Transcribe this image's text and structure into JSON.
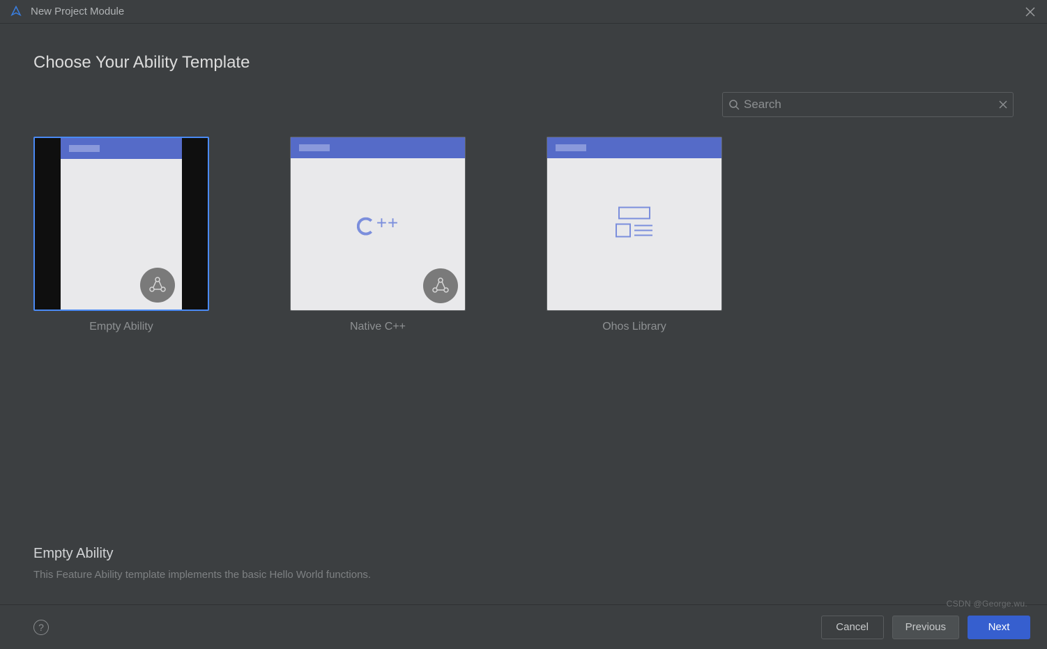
{
  "window": {
    "title": "New Project Module"
  },
  "page": {
    "heading": "Choose Your Ability Template"
  },
  "search": {
    "placeholder": "Search",
    "value": ""
  },
  "templates": [
    {
      "id": "empty-ability",
      "label": "Empty Ability",
      "selected": true
    },
    {
      "id": "native-cpp",
      "label": "Native C++",
      "selected": false
    },
    {
      "id": "ohos-library",
      "label": "Ohos Library",
      "selected": false
    }
  ],
  "detail": {
    "title": "Empty Ability",
    "description": "This Feature Ability template implements the basic Hello World functions."
  },
  "footer": {
    "help_glyph": "?",
    "cancel": "Cancel",
    "previous": "Previous",
    "next": "Next"
  },
  "watermark": "CSDN @George.wu.",
  "colors": {
    "background": "#3c3f41",
    "accent": "#365fcf",
    "selection_border": "#4a8af4",
    "phone_top": "#556bc8"
  }
}
